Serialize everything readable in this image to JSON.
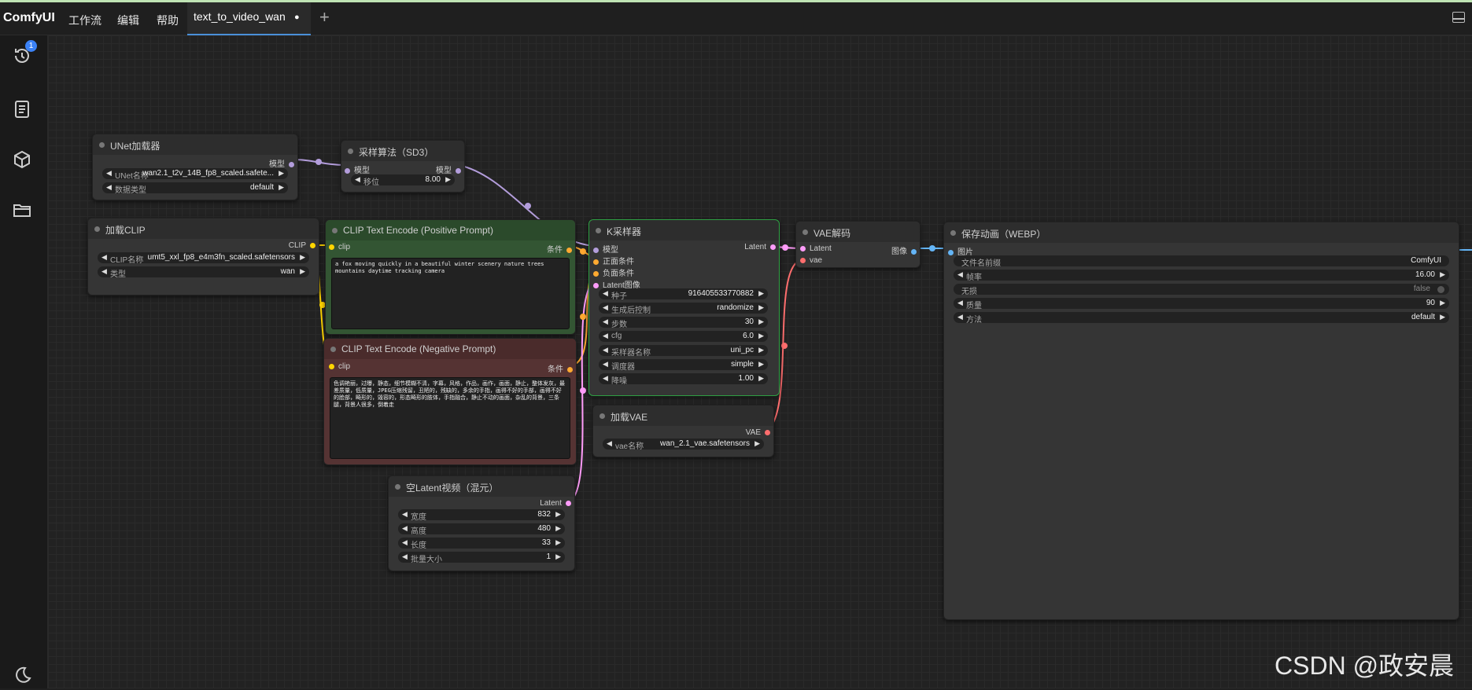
{
  "app": {
    "logo": "ComfyUI"
  },
  "menu": {
    "workflow": "工作流",
    "edit": "编辑",
    "help": "帮助"
  },
  "tab": {
    "label": "text_to_video_wan",
    "unsaved": "●",
    "add": "+"
  },
  "sidebar": {
    "queue_badge": "1"
  },
  "nodes": {
    "unet": {
      "title": "UNet加载器",
      "out_model": "模型",
      "w_unet_label": "UNet名称",
      "w_unet_value": "wan2.1_t2v_14B_fp8_scaled.safete...",
      "w_dtype_label": "数据类型",
      "w_dtype_value": "default"
    },
    "sampling": {
      "title": "采样算法（SD3）",
      "in_model": "模型",
      "out_model": "模型",
      "w_shift_label": "移位",
      "w_shift_value": "8.00"
    },
    "clip_loader": {
      "title": "加载CLIP",
      "out_clip": "CLIP",
      "w_name_label": "CLIP名称",
      "w_name_value": "umt5_xxl_fp8_e4m3fn_scaled.safetensors",
      "w_type_label": "类型",
      "w_type_value": "wan"
    },
    "pos": {
      "title": "CLIP Text Encode (Positive Prompt)",
      "in_clip": "clip",
      "out_cond": "条件",
      "text": "a fox moving quickly in a beautiful winter scenery nature trees mountains daytime tracking camera"
    },
    "neg": {
      "title": "CLIP Text Encode (Negative Prompt)",
      "in_clip": "clip",
      "out_cond": "条件",
      "text": "色调艳丽，过曝，静态，细节模糊不清，字幕，风格，作品，画作，画面，静止，整体发灰，最差质量，低质量，JPEG压缩残留，丑陋的，残缺的，多余的手指，画得不好的手部，画得不好的脸部，畸形的，毁容的，形态畸形的肢体，手指融合，静止不动的画面，杂乱的背景，三条腿，背景人很多，倒着走"
    },
    "ksampler": {
      "title": "K采样器",
      "in_model": "模型",
      "in_pos": "正面条件",
      "in_neg": "负面条件",
      "in_latent": "Latent图像",
      "out_latent": "Latent",
      "w_seed_label": "种子",
      "w_seed_value": "916405533770882",
      "w_ctrl_label": "生成后控制",
      "w_ctrl_value": "randomize",
      "w_steps_label": "步数",
      "w_steps_value": "30",
      "w_cfg_label": "cfg",
      "w_cfg_value": "6.0",
      "w_sampler_label": "采样器名称",
      "w_sampler_value": "uni_pc",
      "w_sched_label": "调度器",
      "w_sched_value": "simple",
      "w_denoise_label": "降噪",
      "w_denoise_value": "1.00"
    },
    "vae_decode": {
      "title": "VAE解码",
      "in_latent": "Latent",
      "in_vae": "vae",
      "out_image": "图像"
    },
    "vae_loader": {
      "title": "加载VAE",
      "out_vae": "VAE",
      "w_name_label": "vae名称",
      "w_name_value": "wan_2.1_vae.safetensors"
    },
    "latent": {
      "title": "空Latent视频（混元）",
      "out_latent": "Latent",
      "w_width_label": "宽度",
      "w_width_value": "832",
      "w_height_label": "高度",
      "w_height_value": "480",
      "w_length_label": "长度",
      "w_length_value": "33",
      "w_batch_label": "批量大小",
      "w_batch_value": "1"
    },
    "save": {
      "title": "保存动画（WEBP）",
      "in_images": "图片",
      "w_prefix_label": "文件名前缀",
      "w_prefix_value": "ComfyUI",
      "w_fps_label": "帧率",
      "w_fps_value": "16.00",
      "w_lossless_label": "无损",
      "w_lossless_value": "false",
      "w_quality_label": "质量",
      "w_quality_value": "90",
      "w_method_label": "方法",
      "w_method_value": "default"
    }
  },
  "colors": {
    "model": "#b39ddb",
    "clip": "#ffd500",
    "conditioning": "#ffa931",
    "latent": "#ff9cf9",
    "vae": "#ff6e6e",
    "image": "#64b5f6",
    "positive_node": "#335533",
    "negative_node": "#553333"
  },
  "watermark": "CSDN @政安晨"
}
